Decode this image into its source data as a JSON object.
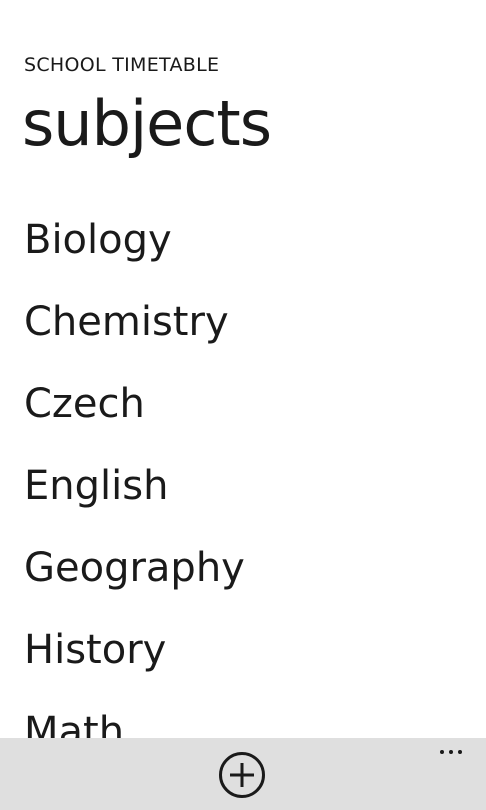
{
  "header": {
    "app_title": "SCHOOL TIMETABLE",
    "page_title": "subjects"
  },
  "subjects": [
    {
      "label": "Biology"
    },
    {
      "label": "Chemistry"
    },
    {
      "label": "Czech"
    },
    {
      "label": "English"
    },
    {
      "label": "Geography"
    },
    {
      "label": "History"
    },
    {
      "label": "Math"
    }
  ],
  "app_bar": {
    "add_icon": "add-circle-icon",
    "more_icon": "ellipsis-icon",
    "background": "#dfdfdf"
  }
}
